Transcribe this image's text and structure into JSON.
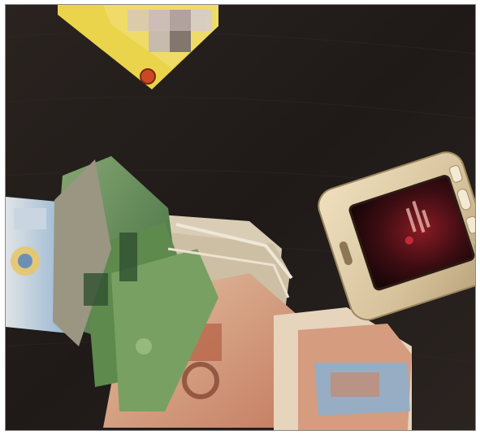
{
  "scene": {
    "objects": [
      {
        "name": "card",
        "colors": {
          "base": "#e9d24a",
          "badge": "#c94a22"
        }
      },
      {
        "name": "banknotes",
        "colors": {
          "green": "#6f9a5a",
          "orange": "#c8876b",
          "blue": "#6d8fb6",
          "paper": "#e8dcc6"
        }
      },
      {
        "name": "mobile-phone",
        "colors": {
          "body": "#d8c6a1",
          "screen": "#3a0c10",
          "screen_glow": "#a01f2a"
        }
      }
    ],
    "background": {
      "surface": "dark wood",
      "color": "#241e1c"
    },
    "caption": ""
  }
}
